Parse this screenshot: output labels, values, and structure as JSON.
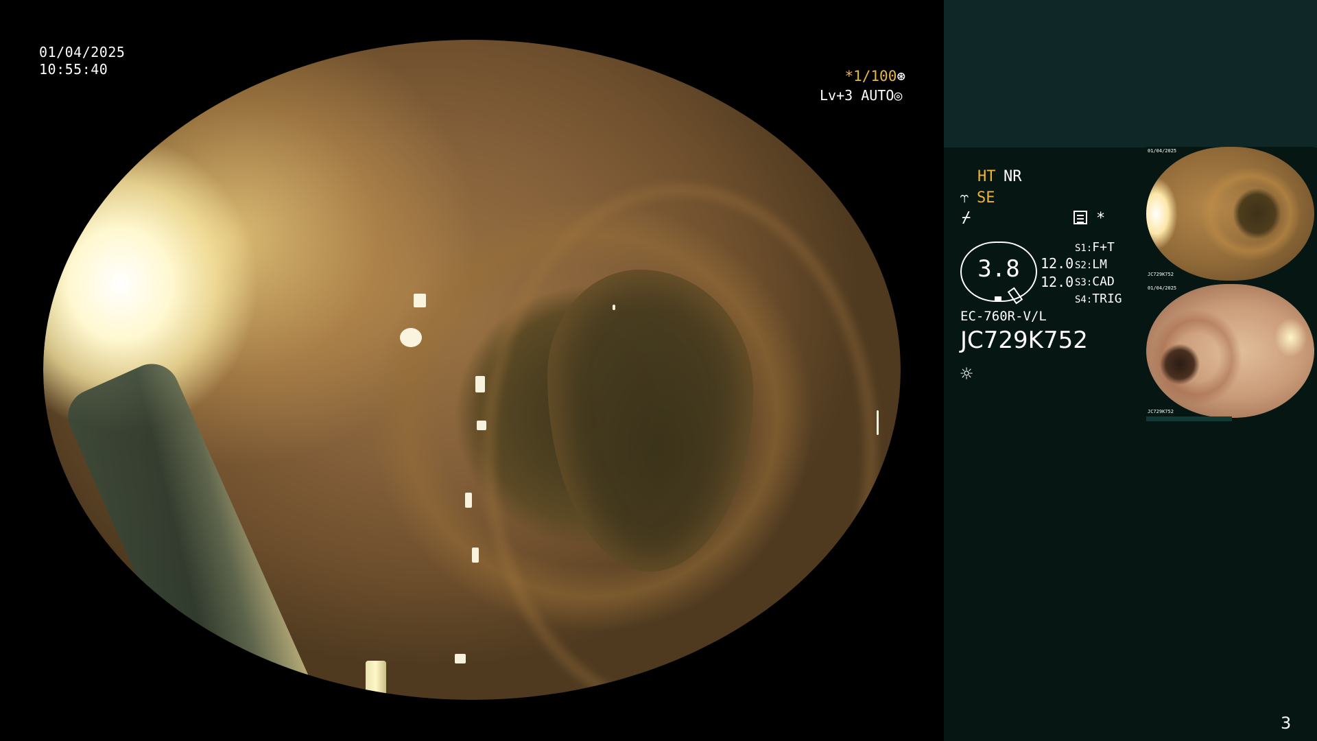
{
  "overlay": {
    "date": "01/04/2025",
    "time": "10:55:40",
    "shutter": "*1/100",
    "shutter_icon": "aperture-icon",
    "level": "Lv+3 AUTO",
    "level_icon": "auto-exposure-icon"
  },
  "panel": {
    "ht": "HT",
    "nr": "NR",
    "se": "SE",
    "se_icon": "scope-mode-icon",
    "flash_icon": "freeze-icon",
    "menu_icon": "menu-icon",
    "star": "*",
    "enhancement_value": "3.8",
    "value_a": "12.0",
    "value_b": "12.0",
    "switches": [
      {
        "key": "S1:",
        "value": "F+T"
      },
      {
        "key": "S2:",
        "value": "LM"
      },
      {
        "key": "S3:",
        "value": "CAD"
      },
      {
        "key": "S4:",
        "value": "TRIG"
      }
    ],
    "scope_model": "EC-760R-V/L",
    "scope_serial": "JC729K752",
    "light_icon": "light-source-icon",
    "accent_color": "#f1b437"
  },
  "thumbnails": [
    {
      "caption_top": "01/04/2025",
      "caption_bottom": "JC729K752"
    },
    {
      "caption_top": "01/04/2025",
      "caption_bottom": "JC729K752"
    }
  ],
  "page_number": "3"
}
